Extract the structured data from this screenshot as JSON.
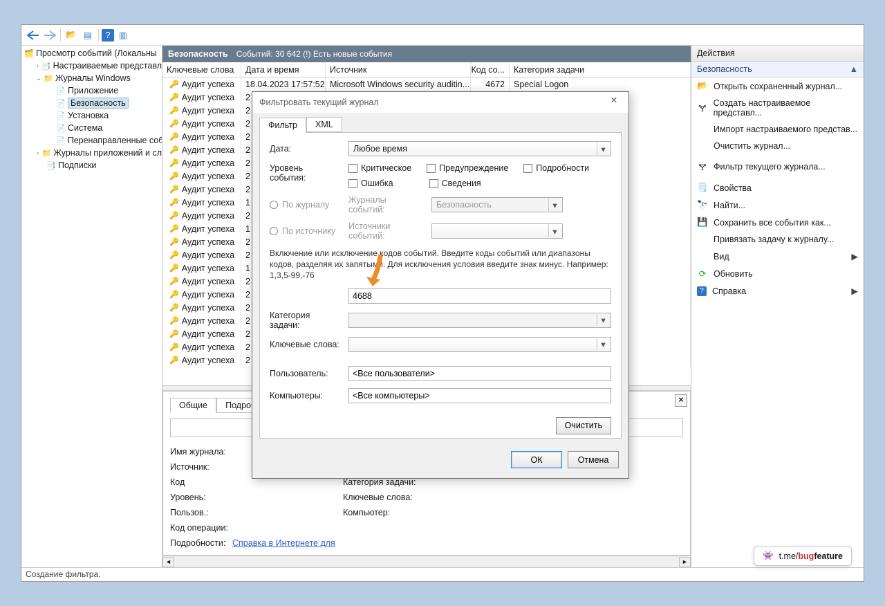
{
  "toolbar": {
    "back": "←",
    "forward": "→",
    "folder": "📁",
    "show": "▦",
    "help": "?",
    "pane": "▥"
  },
  "tree": {
    "root": "Просмотр событий (Локальны",
    "custom": "Настраиваемые представл",
    "winlogs": "Журналы Windows",
    "app": "Приложение",
    "sec": "Безопасность",
    "setup": "Установка",
    "sys": "Система",
    "forwarded": "Перенаправленные соб",
    "appservices": "Журналы приложений и сл",
    "subs": "Подписки"
  },
  "header": {
    "title": "Безопасность",
    "summary": "Событий: 30 642 (!) Есть новые события"
  },
  "cols": {
    "keywords": "Ключевые слова",
    "date": "Дата и время",
    "source": "Источник",
    "code": "Код со...",
    "task": "Категория задачи"
  },
  "row0": {
    "kw": "Аудит успеха",
    "date": "18.04.2023 17:57:52",
    "src": "Microsoft Windows security auditin...",
    "code": "4672",
    "task": "Special Logon"
  },
  "kw_repeat": "Аудит успеха",
  "pd": [
    "2",
    "2",
    "2",
    "2",
    "2",
    "2",
    "2",
    "2",
    "1",
    "2",
    "1",
    "2",
    "2",
    "1",
    "2",
    "2",
    "2",
    "2",
    "2",
    "2",
    "2"
  ],
  "details": {
    "tab_general": "Общие",
    "tab_details": "Подробно",
    "logname": "Имя журнала:",
    "source": "Источник:",
    "code": "Код",
    "level": "Уровень:",
    "user": "Пользов.:",
    "opcode": "Код операции:",
    "more": "Подробности:",
    "cat": "Категория задачи:",
    "kw": "Ключевые слова:",
    "comp": "Компьютер:",
    "link": "Справка в Интернете для"
  },
  "actions": {
    "title": "Действия",
    "section": "Безопасность",
    "open": "Открыть сохраненный журнал...",
    "createView": "Создать настраиваемое представл...",
    "importView": "Импорт настраиваемого представ...",
    "clear": "Очистить журнал...",
    "filter": "Фильтр текущего журнала...",
    "props": "Свойства",
    "find": "Найти...",
    "saveAll": "Сохранить все события как...",
    "bindTask": "Привязать задачу к журналу...",
    "view": "Вид",
    "refresh": "Обновить",
    "help": "Справка"
  },
  "dialog": {
    "title": "Фильтровать текущий журнал",
    "tab_filter": "Фильтр",
    "tab_xml": "XML",
    "date": "Дата:",
    "anytime": "Любое время",
    "level": "Уровень события:",
    "critical": "Критическое",
    "warning": "Предупреждение",
    "verbose": "Подробности",
    "error": "Ошибка",
    "info": "Сведения",
    "byLog": "По журналу",
    "bySource": "По источнику",
    "evLogs": "Журналы событий:",
    "evLogsVal": "Безопасность",
    "evSources": "Источники событий:",
    "help": "Включение или исключение кодов событий. Введите коды событий или диапазоны кодов, разделяя их запятыми. Для исключения условия введите знак минус. Например: 1,3,5-99,-76",
    "idValue": "4688",
    "taskCat": "Категория задачи:",
    "keywords": "Ключевые слова:",
    "user": "Пользователь:",
    "userVal": "<Все пользователи>",
    "computers": "Компьютеры:",
    "compVal": "<Все компьютеры>",
    "clear": "Очистить",
    "ok": "ОК",
    "cancel": "Отмена"
  },
  "status": "Создание фильтра.",
  "badge": {
    "prefix": "t.me/",
    "bug": "bug",
    "feature": "feature"
  }
}
